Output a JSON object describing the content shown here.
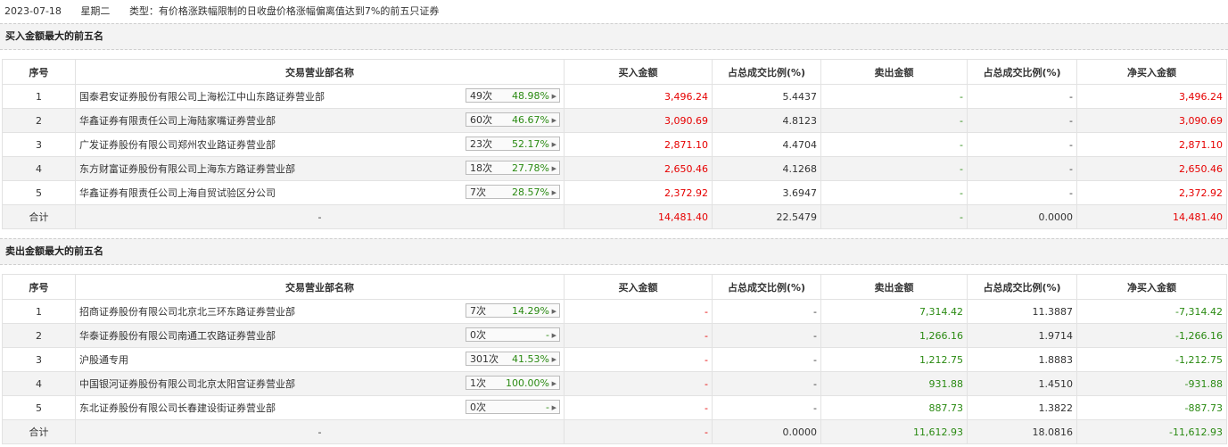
{
  "header": {
    "date": "2023-07-18",
    "weekday": "星期二",
    "type_text": "类型：有价格涨跌幅限制的日收盘价格涨幅偏离值达到7%的前五只证券"
  },
  "columns": [
    "序号",
    "交易营业部名称",
    "买入金额",
    "占总成交比例(%)",
    "卖出金额",
    "占总成交比例(%)",
    "净买入金额"
  ],
  "buy": {
    "title": "买入金额最大的前五名",
    "rows": [
      {
        "no": "1",
        "name": "国泰君安证券股份有限公司上海松江中山东路证券营业部",
        "times": "49次",
        "pct": "48.98%",
        "buy": "3,496.24",
        "buy_ratio": "5.4437",
        "sell": "-",
        "sell_ratio": "-",
        "net": "3,496.24"
      },
      {
        "no": "2",
        "name": "华鑫证券有限责任公司上海陆家嘴证券营业部",
        "times": "60次",
        "pct": "46.67%",
        "buy": "3,090.69",
        "buy_ratio": "4.8123",
        "sell": "-",
        "sell_ratio": "-",
        "net": "3,090.69"
      },
      {
        "no": "3",
        "name": "广发证券股份有限公司郑州农业路证券营业部",
        "times": "23次",
        "pct": "52.17%",
        "buy": "2,871.10",
        "buy_ratio": "4.4704",
        "sell": "-",
        "sell_ratio": "-",
        "net": "2,871.10"
      },
      {
        "no": "4",
        "name": "东方财富证券股份有限公司上海东方路证券营业部",
        "times": "18次",
        "pct": "27.78%",
        "buy": "2,650.46",
        "buy_ratio": "4.1268",
        "sell": "-",
        "sell_ratio": "-",
        "net": "2,650.46"
      },
      {
        "no": "5",
        "name": "华鑫证券有限责任公司上海自贸试验区分公司",
        "times": "7次",
        "pct": "28.57%",
        "buy": "2,372.92",
        "buy_ratio": "3.6947",
        "sell": "-",
        "sell_ratio": "-",
        "net": "2,372.92"
      }
    ],
    "total": {
      "label": "合计",
      "name": "-",
      "buy": "14,481.40",
      "buy_ratio": "22.5479",
      "sell": "-",
      "sell_ratio": "0.0000",
      "net": "14,481.40"
    }
  },
  "sell": {
    "title": "卖出金额最大的前五名",
    "rows": [
      {
        "no": "1",
        "name": "招商证券股份有限公司北京北三环东路证券营业部",
        "times": "7次",
        "pct": "14.29%",
        "buy": "-",
        "buy_ratio": "-",
        "sell": "7,314.42",
        "sell_ratio": "11.3887",
        "net": "-7,314.42"
      },
      {
        "no": "2",
        "name": "华泰证券股份有限公司南通工农路证券营业部",
        "times": "0次",
        "pct": "-",
        "buy": "-",
        "buy_ratio": "-",
        "sell": "1,266.16",
        "sell_ratio": "1.9714",
        "net": "-1,266.16"
      },
      {
        "no": "3",
        "name": "沪股通专用",
        "times": "301次",
        "pct": "41.53%",
        "buy": "-",
        "buy_ratio": "-",
        "sell": "1,212.75",
        "sell_ratio": "1.8883",
        "net": "-1,212.75"
      },
      {
        "no": "4",
        "name": "中国银河证券股份有限公司北京太阳宫证券营业部",
        "times": "1次",
        "pct": "100.00%",
        "buy": "-",
        "buy_ratio": "-",
        "sell": "931.88",
        "sell_ratio": "1.4510",
        "net": "-931.88"
      },
      {
        "no": "5",
        "name": "东北证券股份有限公司长春建设街证券营业部",
        "times": "0次",
        "pct": "-",
        "buy": "-",
        "buy_ratio": "-",
        "sell": "887.73",
        "sell_ratio": "1.3822",
        "net": "-887.73"
      }
    ],
    "total": {
      "label": "合计",
      "name": "-",
      "buy": "-",
      "buy_ratio": "0.0000",
      "sell": "11,612.93",
      "sell_ratio": "18.0816",
      "net": "-11,612.93"
    }
  },
  "colors": {
    "positive": "#e60000",
    "negative": "#2a8a12",
    "alt_row": "#f3f3f3"
  }
}
